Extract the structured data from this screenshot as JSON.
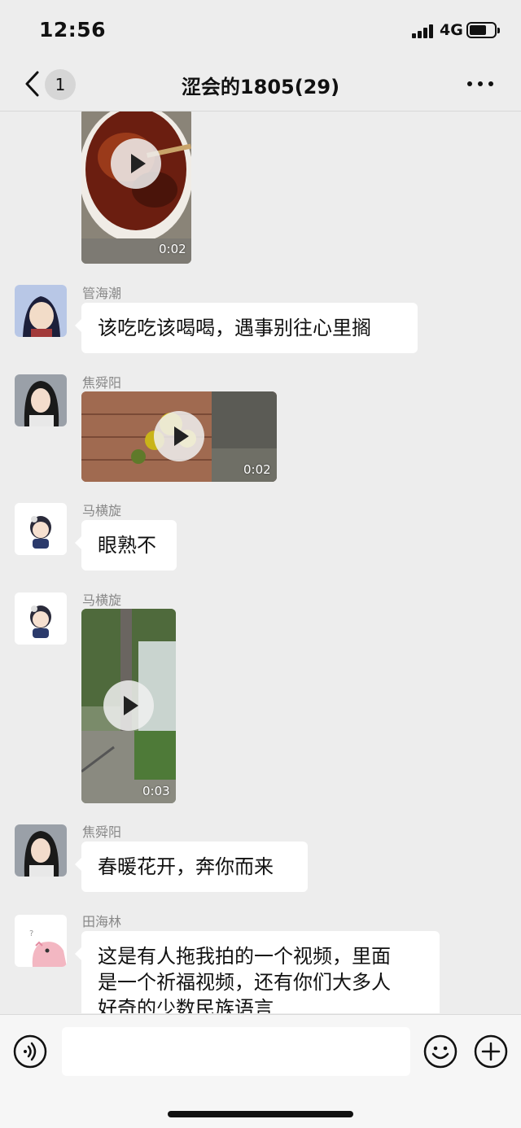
{
  "status_bar": {
    "time": "12:56",
    "network": "4G"
  },
  "nav": {
    "unread_count": "1",
    "title": "涩会的1805(29)"
  },
  "messages": [
    {
      "type": "video",
      "duration": "0:02"
    },
    {
      "type": "text",
      "sender": "管海潮",
      "text": "该吃吃该喝喝，遇事别往心里搁"
    },
    {
      "type": "video",
      "sender": "焦舜阳",
      "duration": "0:02"
    },
    {
      "type": "text",
      "sender": "马横旋",
      "text": "眼熟不"
    },
    {
      "type": "video",
      "sender": "马横旋",
      "duration": "0:03"
    },
    {
      "type": "text",
      "sender": "焦舜阳",
      "text": "春暖花开，奔你而来"
    },
    {
      "type": "text",
      "sender": "田海林",
      "lines": [
        "这是有人拖我拍的一个视频，里面",
        "是一个祈福视频，还有你们大多人",
        "好奇的少数民族语言"
      ]
    }
  ],
  "icons": {
    "back": "chevron-left-icon",
    "more": "more-dots-icon",
    "voice": "voice-icon",
    "emoji": "emoji-icon",
    "plus": "plus-icon",
    "play": "play-icon"
  },
  "colors": {
    "background": "#ededed",
    "bubble": "#ffffff",
    "input_bar": "#f6f6f6"
  }
}
